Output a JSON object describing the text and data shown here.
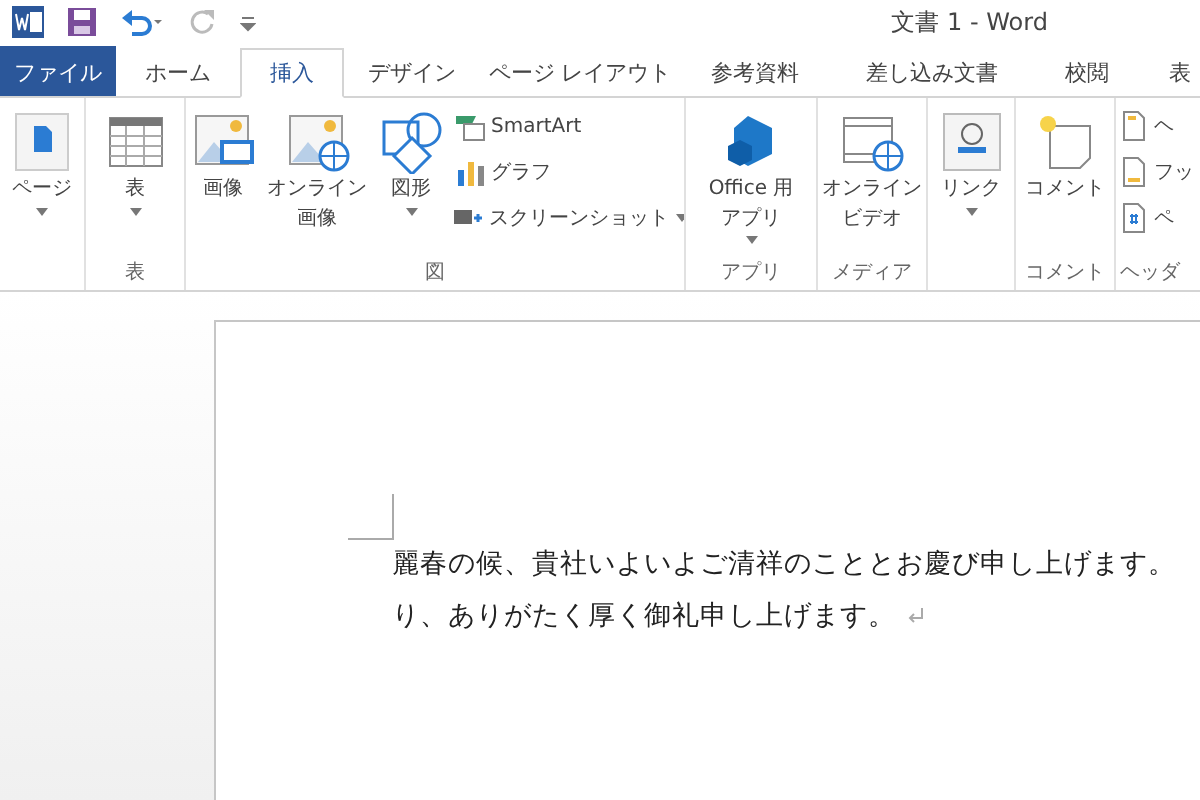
{
  "window": {
    "title": "文書 1 - Word"
  },
  "tabs": [
    {
      "label": "ファイル",
      "kind": "file",
      "selected": false
    },
    {
      "label": "ホーム",
      "kind": "tab",
      "selected": false
    },
    {
      "label": "挿入",
      "kind": "tab",
      "selected": true
    },
    {
      "label": "デザイン",
      "kind": "tab",
      "selected": false
    },
    {
      "label": "ページ レイアウト",
      "kind": "tab",
      "selected": false
    },
    {
      "label": "参考資料",
      "kind": "tab",
      "selected": false
    },
    {
      "label": "差し込み文書",
      "kind": "tab",
      "selected": false
    },
    {
      "label": "校閲",
      "kind": "tab",
      "selected": false
    },
    {
      "label": "表",
      "kind": "tab",
      "selected": false
    }
  ],
  "ribbon_groups": [
    {
      "items": [
        {
          "kind": "large",
          "label_lines": [
            "ページ"
          ],
          "dropdown": true
        }
      ]
    },
    {
      "label": "表",
      "items": [
        {
          "kind": "large",
          "label_lines": [
            "表"
          ],
          "dropdown": true
        }
      ]
    },
    {
      "label": "図",
      "items": [
        {
          "kind": "large",
          "label_lines": [
            "画像"
          ],
          "dropdown": false
        },
        {
          "kind": "large",
          "label_lines": [
            "オンライン",
            "画像"
          ],
          "dropdown": false
        },
        {
          "kind": "large",
          "label_lines": [
            "図形"
          ],
          "dropdown": true
        },
        {
          "kind": "small",
          "label_lines": [
            "SmartArt"
          ],
          "dropdown": false
        },
        {
          "kind": "small",
          "label_lines": [
            "グラフ"
          ],
          "dropdown": false
        },
        {
          "kind": "small",
          "label_lines": [
            "スクリーンショット"
          ],
          "dropdown": true
        }
      ]
    },
    {
      "label": "アプリ",
      "items": [
        {
          "kind": "large",
          "label_lines": [
            "Office 用",
            "アプリ"
          ],
          "dropdown": true
        }
      ]
    },
    {
      "label": "メディア",
      "items": [
        {
          "kind": "large",
          "label_lines": [
            "オンライン",
            "ビデオ"
          ],
          "dropdown": false
        }
      ]
    },
    {
      "items": [
        {
          "kind": "large",
          "label_lines": [
            "リンク"
          ],
          "dropdown": true
        }
      ]
    },
    {
      "label": "コメント",
      "items": [
        {
          "kind": "large",
          "label_lines": [
            "コメント"
          ],
          "dropdown": false
        }
      ]
    },
    {
      "label": "ヘッダ",
      "items": [
        {
          "kind": "small",
          "label_lines": [
            "ヘ"
          ]
        },
        {
          "kind": "small",
          "label_lines": [
            "フッ"
          ]
        },
        {
          "kind": "small",
          "label_lines": [
            "ペ"
          ]
        }
      ]
    }
  ],
  "document": {
    "lines": [
      "麗春の候、貴社いよいよご清祥のこととお慶び申し上げます。",
      "り、ありがたく厚く御礼申し上げます。"
    ]
  }
}
